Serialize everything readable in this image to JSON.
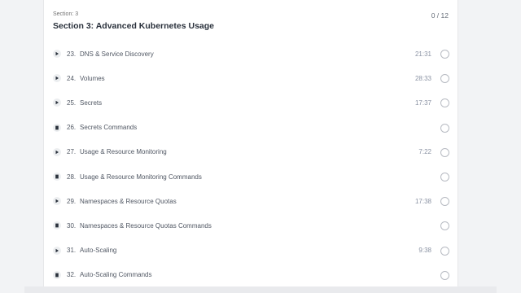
{
  "section": {
    "label": "Section: 3",
    "title": "Section 3: Advanced Kubernetes Usage",
    "progress": "0 / 12"
  },
  "lectures": [
    {
      "number": "23.",
      "title": "DNS & Service Discovery",
      "duration": "21:31",
      "icon": "play-icon"
    },
    {
      "number": "24.",
      "title": "Volumes",
      "duration": "28:33",
      "icon": "play-icon"
    },
    {
      "number": "25.",
      "title": "Secrets",
      "duration": "17:37",
      "icon": "play-icon"
    },
    {
      "number": "26.",
      "title": "Secrets Commands",
      "duration": "",
      "icon": "document-icon"
    },
    {
      "number": "27.",
      "title": "Usage & Resource Monitoring",
      "duration": "7:22",
      "icon": "play-icon"
    },
    {
      "number": "28.",
      "title": "Usage & Resource Monitoring Commands",
      "duration": "",
      "icon": "document-icon"
    },
    {
      "number": "29.",
      "title": "Namespaces & Resource Quotas",
      "duration": "17:38",
      "icon": "play-icon"
    },
    {
      "number": "30.",
      "title": "Namespaces & Resource Quotas Commands",
      "duration": "",
      "icon": "document-icon"
    },
    {
      "number": "31.",
      "title": "Auto-Scaling",
      "duration": "9:38",
      "icon": "play-icon"
    },
    {
      "number": "32.",
      "title": "Auto-Scaling Commands",
      "duration": "",
      "icon": "document-icon"
    }
  ]
}
